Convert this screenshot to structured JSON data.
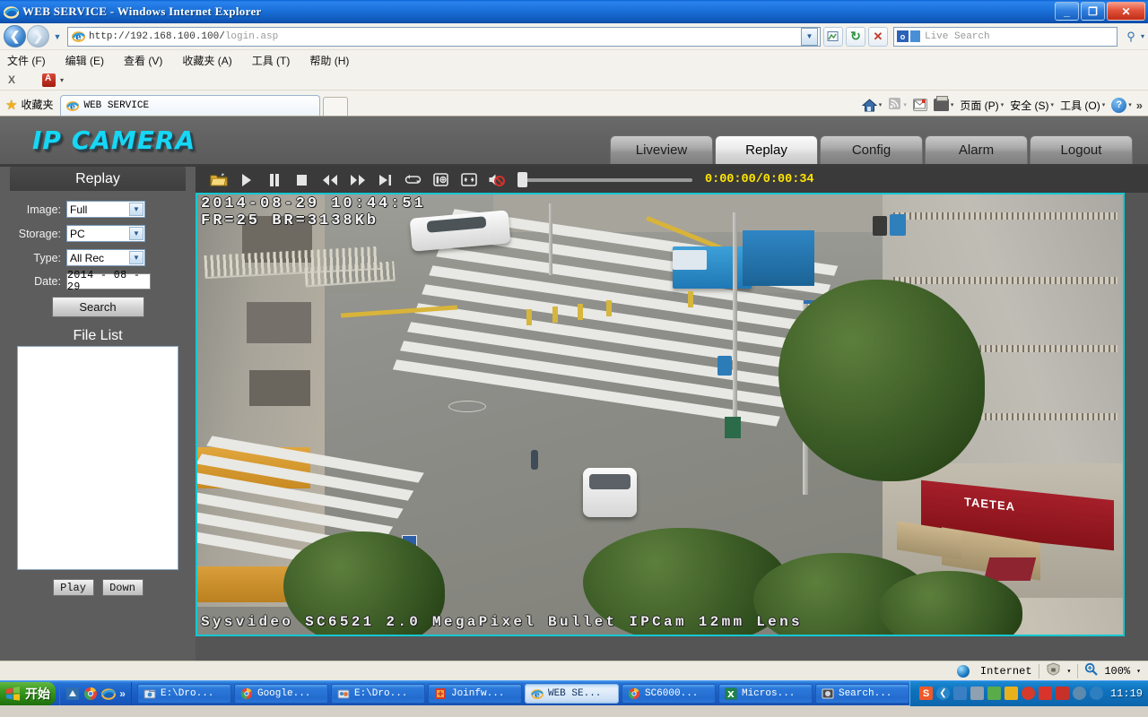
{
  "window": {
    "title": "WEB SERVICE - Windows Internet Explorer",
    "minimize_label": "_",
    "maximize_label": "❐",
    "close_label": "✕"
  },
  "browser": {
    "back_label": "❮",
    "forward_label": "❯",
    "history_dropdown_label": "▼",
    "address_url_prefix": "http://192.168.100.100/",
    "address_url_suffix": "login.asp",
    "address_dropdown_label": "▼",
    "refresh_label": "↻",
    "stop_label": "✕",
    "compat_label": "⌗",
    "search_placeholder": "Live Search",
    "search_go_label": "⚲",
    "search_dropdown_label": "▾",
    "menu": [
      "文件 (F)",
      "编辑 (E)",
      "查看 (V)",
      "收藏夹 (A)",
      "工具 (T)",
      "帮助 (H)"
    ],
    "command_bar": {
      "close_label": "X",
      "pdf_dropdown_label": "▾"
    },
    "favorites_label": "收藏夹",
    "tab_label": "WEB SERVICE",
    "new_tab_label": "",
    "toolbar_right": [
      {
        "name": "home",
        "label": "",
        "caret": "▾"
      },
      {
        "name": "feeds",
        "label": "",
        "caret": "▾"
      },
      {
        "name": "mail",
        "label": "",
        "caret": ""
      },
      {
        "name": "print",
        "label": "",
        "caret": "▾"
      },
      {
        "name": "page",
        "label": "页面 (P)",
        "caret": "▾"
      },
      {
        "name": "safety",
        "label": "安全 (S)",
        "caret": "▾"
      },
      {
        "name": "tools",
        "label": "工具 (O)",
        "caret": "▾"
      },
      {
        "name": "help",
        "label": "",
        "caret": "▾"
      }
    ],
    "overflow_label": "»"
  },
  "camera": {
    "logo": "IP CAMERA",
    "nav_tabs": [
      {
        "label": "Liveview",
        "active": false
      },
      {
        "label": "Replay",
        "active": true
      },
      {
        "label": "Config",
        "active": false
      },
      {
        "label": "Alarm",
        "active": false
      },
      {
        "label": "Logout",
        "active": false
      }
    ],
    "sidebar": {
      "title": "Replay",
      "fields": [
        {
          "label": "Image:",
          "value": "Full",
          "type": "select"
        },
        {
          "label": "Storage:",
          "value": "PC",
          "type": "select"
        },
        {
          "label": "Type:",
          "value": "All Rec",
          "type": "select"
        }
      ],
      "date_label": "Date:",
      "date_value": "2014 - 08 - 29",
      "search_button": "Search",
      "file_list_title": "File List",
      "file_list_items": [],
      "play_button": "Play",
      "down_button": "Down"
    },
    "player": {
      "controls": [
        {
          "name": "open-file",
          "glyph": "📂"
        },
        {
          "name": "play",
          "glyph": "▶"
        },
        {
          "name": "pause",
          "glyph": "▐▌"
        },
        {
          "name": "stop",
          "glyph": "■"
        },
        {
          "name": "rewind",
          "glyph": "◀◀"
        },
        {
          "name": "fast-forward",
          "glyph": "▶▶"
        },
        {
          "name": "step-frame",
          "glyph": "▶|"
        },
        {
          "name": "loop",
          "glyph": "↺"
        },
        {
          "name": "snapshot",
          "glyph": "📷"
        },
        {
          "name": "fullscreen",
          "glyph": "⛶"
        },
        {
          "name": "mute",
          "glyph": "🔇"
        }
      ],
      "progress_value": 0,
      "time_display": "0:00:00/0:00:34"
    },
    "video_osd": {
      "line1": "2014-08-29 10:44:51",
      "line2": "FR=25 BR=3138Kb",
      "bottom": "Sysvideo SC6521 2.0 MegaPixel Bullet IPCam 12mm Lens",
      "shop_sign": "TAETEA"
    }
  },
  "statusbar": {
    "zone_label": "Internet",
    "protected_mode_caret": "▾",
    "zoom_label": "100%",
    "zoom_caret": "▾"
  },
  "taskbar": {
    "start_label": "开始",
    "quicklaunch_overflow": "»",
    "items": [
      {
        "label": "E:\\Dro...",
        "active": false,
        "icon": "folder-icon"
      },
      {
        "label": "Google...",
        "active": false,
        "icon": "chrome-icon"
      },
      {
        "label": "E:\\Dro...",
        "active": false,
        "icon": "folder-icon"
      },
      {
        "label": "Joinfw...",
        "active": false,
        "icon": "app-icon"
      },
      {
        "label": "WEB SE...",
        "active": true,
        "icon": "ie-icon"
      },
      {
        "label": "SC6000...",
        "active": false,
        "icon": "chrome-icon"
      },
      {
        "label": "Micros...",
        "active": false,
        "icon": "excel-icon"
      },
      {
        "label": "Search...",
        "active": false,
        "icon": "app-icon"
      }
    ],
    "tray_expand": "❮",
    "clock": "11:19"
  },
  "colors": {
    "accent_cyan": "#16d7f5",
    "video_border": "#14c8d2",
    "timer_yellow": "#ffe600",
    "panel_gray": "#5d5d5d",
    "titlebar_blue": "#1a6fd8"
  }
}
